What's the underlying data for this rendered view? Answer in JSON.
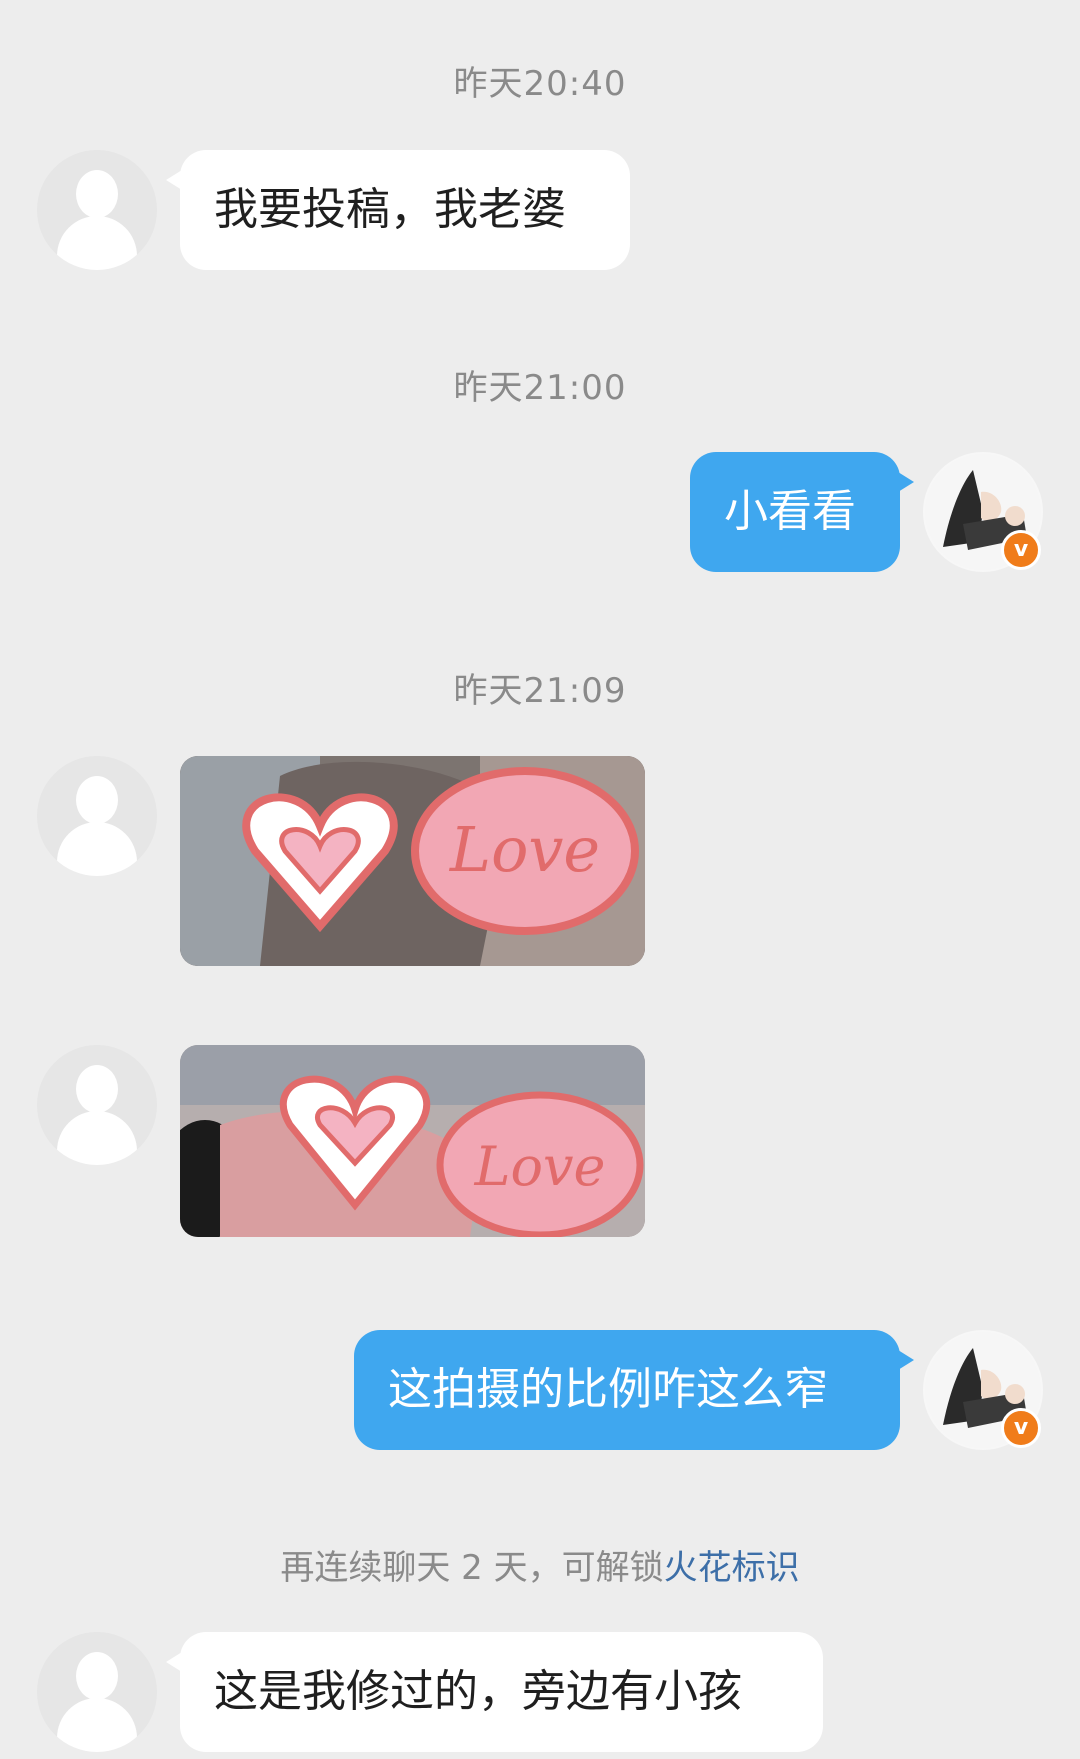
{
  "messages": [
    {
      "time": "昨天20:40"
    },
    {
      "text": "我要投稿，我老婆"
    },
    {
      "time": "昨天21:00"
    },
    {
      "text": "小看看"
    },
    {
      "time": "昨天21:09"
    },
    {
      "text": "这拍摄的比例咋这么窄"
    },
    {
      "text": "这是我修过的，旁边有小孩"
    }
  ],
  "verified_badge": "v",
  "sticker_text": "Love",
  "notice": {
    "prefix": "再连续聊天 2 天，可解锁",
    "link": "火花标识"
  },
  "colors": {
    "background": "#ededed",
    "incoming_bubble": "#ffffff",
    "outgoing_bubble": "#3fa7ef",
    "timestamp": "#8a8a8a",
    "link": "#3d6fa8",
    "badge": "#f07c1a"
  }
}
